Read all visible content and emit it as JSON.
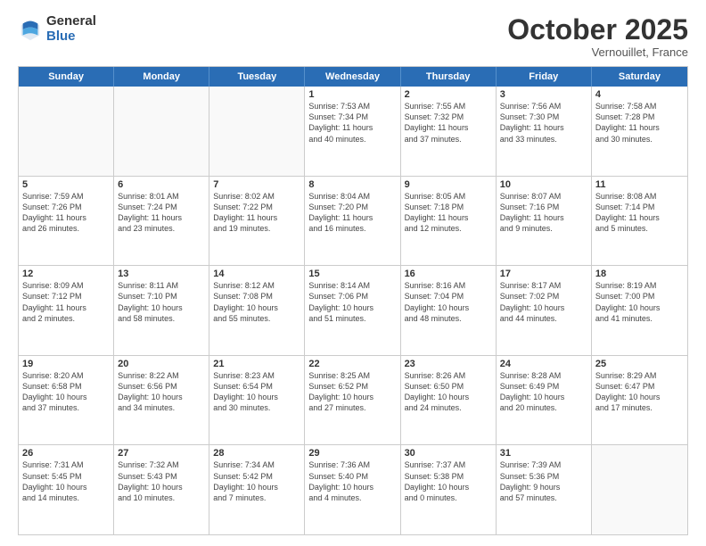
{
  "logo": {
    "general": "General",
    "blue": "Blue"
  },
  "header": {
    "month": "October 2025",
    "location": "Vernouillet, France"
  },
  "weekdays": [
    "Sunday",
    "Monday",
    "Tuesday",
    "Wednesday",
    "Thursday",
    "Friday",
    "Saturday"
  ],
  "rows": [
    [
      {
        "day": "",
        "info": ""
      },
      {
        "day": "",
        "info": ""
      },
      {
        "day": "",
        "info": ""
      },
      {
        "day": "1",
        "info": "Sunrise: 7:53 AM\nSunset: 7:34 PM\nDaylight: 11 hours\nand 40 minutes."
      },
      {
        "day": "2",
        "info": "Sunrise: 7:55 AM\nSunset: 7:32 PM\nDaylight: 11 hours\nand 37 minutes."
      },
      {
        "day": "3",
        "info": "Sunrise: 7:56 AM\nSunset: 7:30 PM\nDaylight: 11 hours\nand 33 minutes."
      },
      {
        "day": "4",
        "info": "Sunrise: 7:58 AM\nSunset: 7:28 PM\nDaylight: 11 hours\nand 30 minutes."
      }
    ],
    [
      {
        "day": "5",
        "info": "Sunrise: 7:59 AM\nSunset: 7:26 PM\nDaylight: 11 hours\nand 26 minutes."
      },
      {
        "day": "6",
        "info": "Sunrise: 8:01 AM\nSunset: 7:24 PM\nDaylight: 11 hours\nand 23 minutes."
      },
      {
        "day": "7",
        "info": "Sunrise: 8:02 AM\nSunset: 7:22 PM\nDaylight: 11 hours\nand 19 minutes."
      },
      {
        "day": "8",
        "info": "Sunrise: 8:04 AM\nSunset: 7:20 PM\nDaylight: 11 hours\nand 16 minutes."
      },
      {
        "day": "9",
        "info": "Sunrise: 8:05 AM\nSunset: 7:18 PM\nDaylight: 11 hours\nand 12 minutes."
      },
      {
        "day": "10",
        "info": "Sunrise: 8:07 AM\nSunset: 7:16 PM\nDaylight: 11 hours\nand 9 minutes."
      },
      {
        "day": "11",
        "info": "Sunrise: 8:08 AM\nSunset: 7:14 PM\nDaylight: 11 hours\nand 5 minutes."
      }
    ],
    [
      {
        "day": "12",
        "info": "Sunrise: 8:09 AM\nSunset: 7:12 PM\nDaylight: 11 hours\nand 2 minutes."
      },
      {
        "day": "13",
        "info": "Sunrise: 8:11 AM\nSunset: 7:10 PM\nDaylight: 10 hours\nand 58 minutes."
      },
      {
        "day": "14",
        "info": "Sunrise: 8:12 AM\nSunset: 7:08 PM\nDaylight: 10 hours\nand 55 minutes."
      },
      {
        "day": "15",
        "info": "Sunrise: 8:14 AM\nSunset: 7:06 PM\nDaylight: 10 hours\nand 51 minutes."
      },
      {
        "day": "16",
        "info": "Sunrise: 8:16 AM\nSunset: 7:04 PM\nDaylight: 10 hours\nand 48 minutes."
      },
      {
        "day": "17",
        "info": "Sunrise: 8:17 AM\nSunset: 7:02 PM\nDaylight: 10 hours\nand 44 minutes."
      },
      {
        "day": "18",
        "info": "Sunrise: 8:19 AM\nSunset: 7:00 PM\nDaylight: 10 hours\nand 41 minutes."
      }
    ],
    [
      {
        "day": "19",
        "info": "Sunrise: 8:20 AM\nSunset: 6:58 PM\nDaylight: 10 hours\nand 37 minutes."
      },
      {
        "day": "20",
        "info": "Sunrise: 8:22 AM\nSunset: 6:56 PM\nDaylight: 10 hours\nand 34 minutes."
      },
      {
        "day": "21",
        "info": "Sunrise: 8:23 AM\nSunset: 6:54 PM\nDaylight: 10 hours\nand 30 minutes."
      },
      {
        "day": "22",
        "info": "Sunrise: 8:25 AM\nSunset: 6:52 PM\nDaylight: 10 hours\nand 27 minutes."
      },
      {
        "day": "23",
        "info": "Sunrise: 8:26 AM\nSunset: 6:50 PM\nDaylight: 10 hours\nand 24 minutes."
      },
      {
        "day": "24",
        "info": "Sunrise: 8:28 AM\nSunset: 6:49 PM\nDaylight: 10 hours\nand 20 minutes."
      },
      {
        "day": "25",
        "info": "Sunrise: 8:29 AM\nSunset: 6:47 PM\nDaylight: 10 hours\nand 17 minutes."
      }
    ],
    [
      {
        "day": "26",
        "info": "Sunrise: 7:31 AM\nSunset: 5:45 PM\nDaylight: 10 hours\nand 14 minutes."
      },
      {
        "day": "27",
        "info": "Sunrise: 7:32 AM\nSunset: 5:43 PM\nDaylight: 10 hours\nand 10 minutes."
      },
      {
        "day": "28",
        "info": "Sunrise: 7:34 AM\nSunset: 5:42 PM\nDaylight: 10 hours\nand 7 minutes."
      },
      {
        "day": "29",
        "info": "Sunrise: 7:36 AM\nSunset: 5:40 PM\nDaylight: 10 hours\nand 4 minutes."
      },
      {
        "day": "30",
        "info": "Sunrise: 7:37 AM\nSunset: 5:38 PM\nDaylight: 10 hours\nand 0 minutes."
      },
      {
        "day": "31",
        "info": "Sunrise: 7:39 AM\nSunset: 5:36 PM\nDaylight: 9 hours\nand 57 minutes."
      },
      {
        "day": "",
        "info": ""
      }
    ]
  ]
}
